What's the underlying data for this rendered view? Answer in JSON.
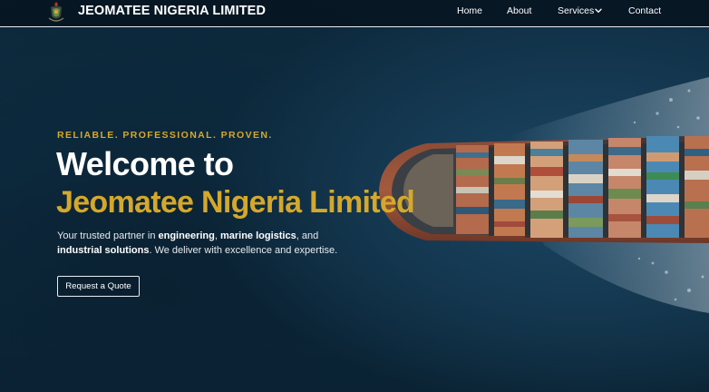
{
  "brand": {
    "name": "JEOMATEE NIGERIA LIMITED",
    "logo_icon": "coat-of-arms-icon"
  },
  "nav": {
    "home": "Home",
    "about": "About",
    "services": "Services",
    "contact": "Contact",
    "services_icon": "chevron-down-icon"
  },
  "hero": {
    "tagline": "RELIABLE. PROFESSIONAL. PROVEN.",
    "title_line1": "Welcome to",
    "title_line2": "Jeomatee Nigeria Limited",
    "description": {
      "part1": "Your trusted partner in ",
      "bold1": "engineering",
      "part2": ", ",
      "bold2": "marine logistics",
      "part3": ", and ",
      "bold3": "industrial solutions",
      "part4": ". We deliver with excellence and expertise."
    },
    "cta_label": "Request a Quote",
    "background_image": "container-ship-aerial"
  },
  "colors": {
    "accent_gold": "#d4a82c",
    "navbar_bg": "#061622",
    "ocean_dark": "#0b2233",
    "text_white": "#ffffff"
  }
}
